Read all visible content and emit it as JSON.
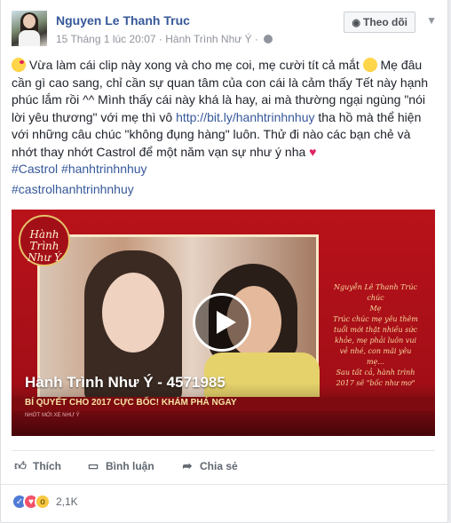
{
  "post": {
    "author": "Nguyen Le Thanh Truc",
    "timestamp": "15 Tháng 1 lúc 20:07",
    "separator": "·",
    "page": "Hành Trình Như Ý",
    "follow_label": "Theo dõi",
    "text_part1": " Vừa làm cái clip này xong và cho mẹ coi, mẹ cười tít cả mắt ",
    "text_part2": " Mẹ đâu cần gì cao sang, chỉ cần sự quan tâm của con cái là cảm thấy Tết này hạnh phúc lắm rồi ^^ Mình thấy cái này khá là hay, ai mà thường ngại ngùng \"nói lời yêu thương\" với mẹ thì vô ",
    "link": "http://bit.ly/hanhtrinhnhuy",
    "text_part3": " tha hồ mà thể hiện với những câu chúc \"không đụng hàng\" luôn. Thử đi nào các bạn chẻ và nhớt thay nhớt Castrol để một năm vạn sự như ý nha ",
    "hashtag1": "#Castrol",
    "hashtag2": "#hanhtrinhnhuy",
    "hashtag3": "#castrolhanhtrinhnhuy"
  },
  "video": {
    "logo": "Hành Trình Như Ý",
    "greeting": "Nguyễn Lê Thanh Trúc\nchúc\nMẹ\nTrúc chúc mẹ yêu thêm\ntuổi mới thật nhiều sức\nkhỏe, mẹ phải luôn vui\nvẻ nhé, con mãi yêu\nmẹ...\nSau tất cả, hành trình\n2017 sẽ \"bốc như mơ\"",
    "title": "Hành Trình Như Ý - 4571985",
    "subtitle": "BÍ QUYẾT CHO 2017 CỰC BỐC! KHÁM PHÁ NGAY",
    "footer": "NHỚT MỚI XE NHƯ Ý"
  },
  "actions": {
    "like": "Thích",
    "comment": "Bình luận",
    "share": "Chia sẻ"
  },
  "reactions": {
    "count": "2,1K"
  }
}
